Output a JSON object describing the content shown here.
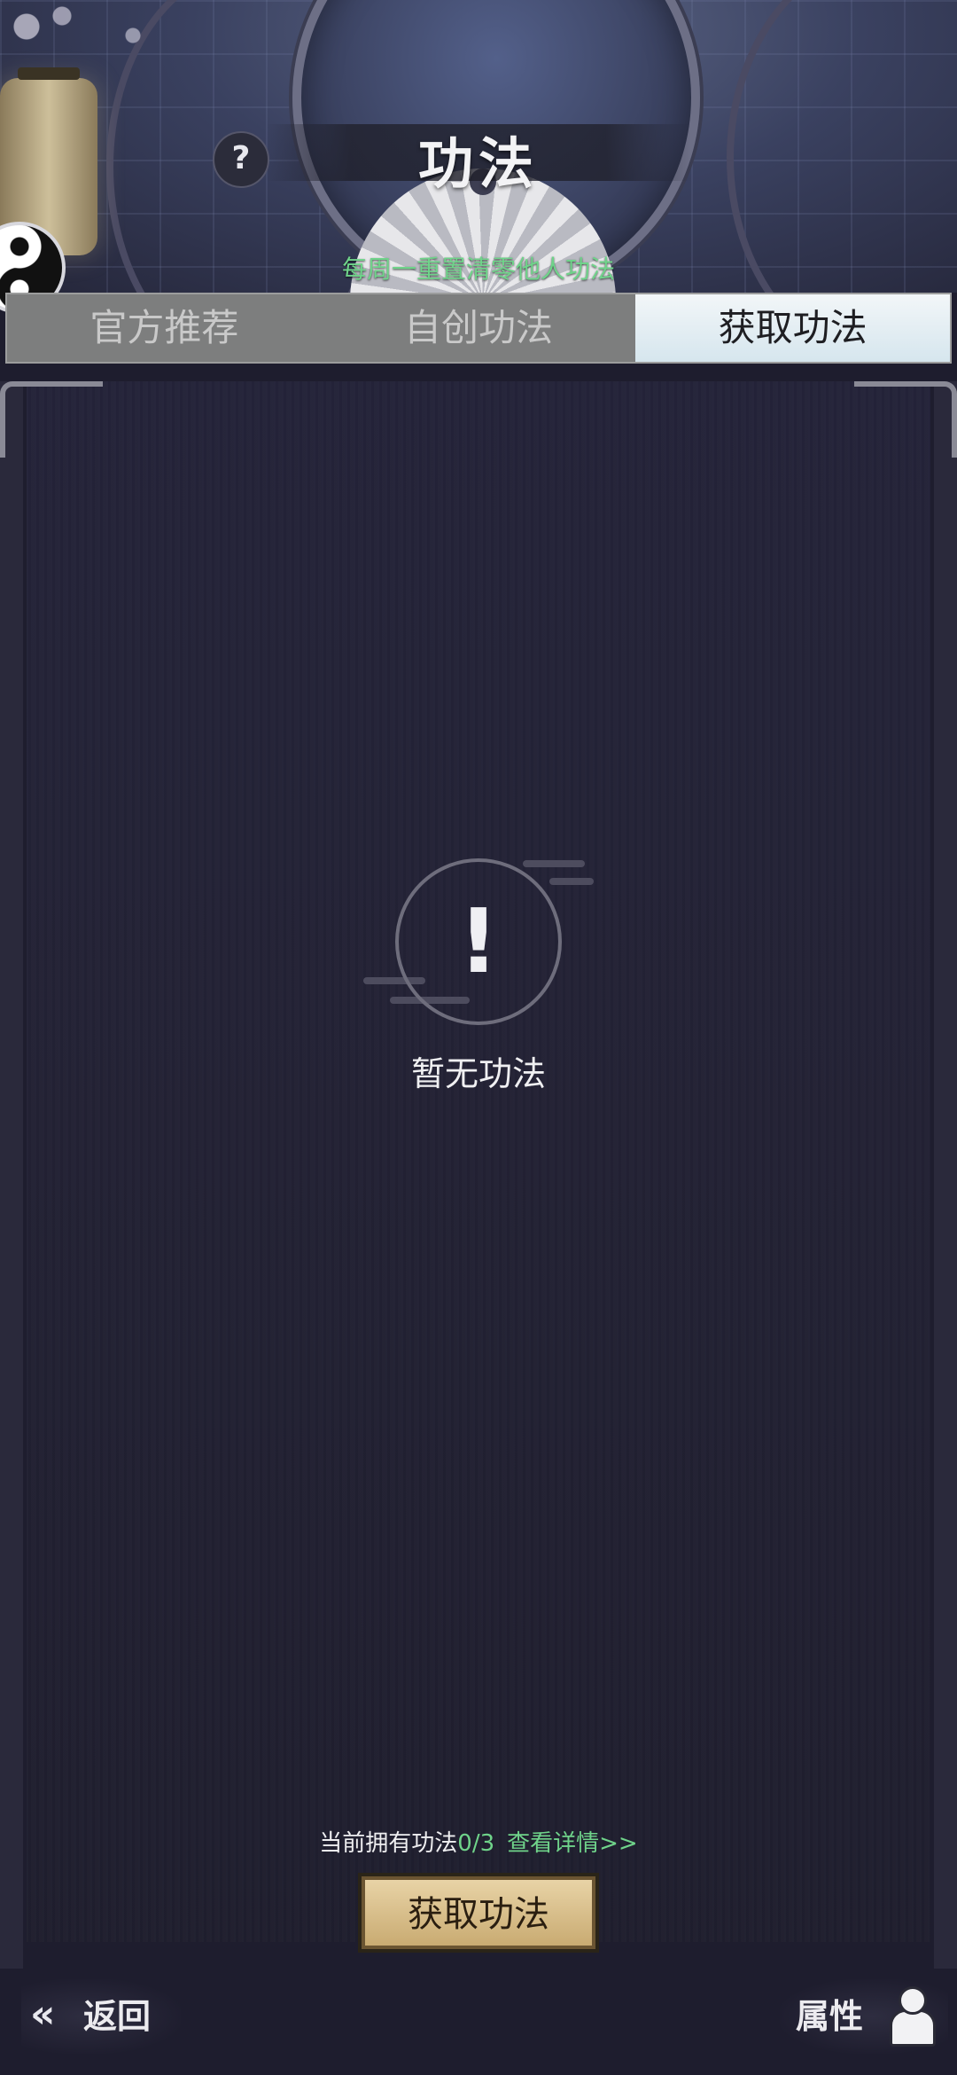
{
  "header": {
    "title": "功法",
    "help_icon": "?",
    "subtitle": "每周一重置清零他人功法"
  },
  "tabs": [
    {
      "label": "官方推荐",
      "active": false
    },
    {
      "label": "自创功法",
      "active": false
    },
    {
      "label": "获取功法",
      "active": true
    }
  ],
  "empty_state": {
    "icon": "!",
    "text": "暂无功法"
  },
  "footer": {
    "owned_label": "当前拥有功法",
    "owned_count": "0/3",
    "detail_link": "查看详情>>",
    "obtain_button": "获取功法"
  },
  "bottom_nav": {
    "back_label": "返回",
    "attributes_label": "属性"
  },
  "colors": {
    "accent_green": "#6fd38a",
    "button_gold": "#d8bd88",
    "panel_bg": "#232235"
  }
}
